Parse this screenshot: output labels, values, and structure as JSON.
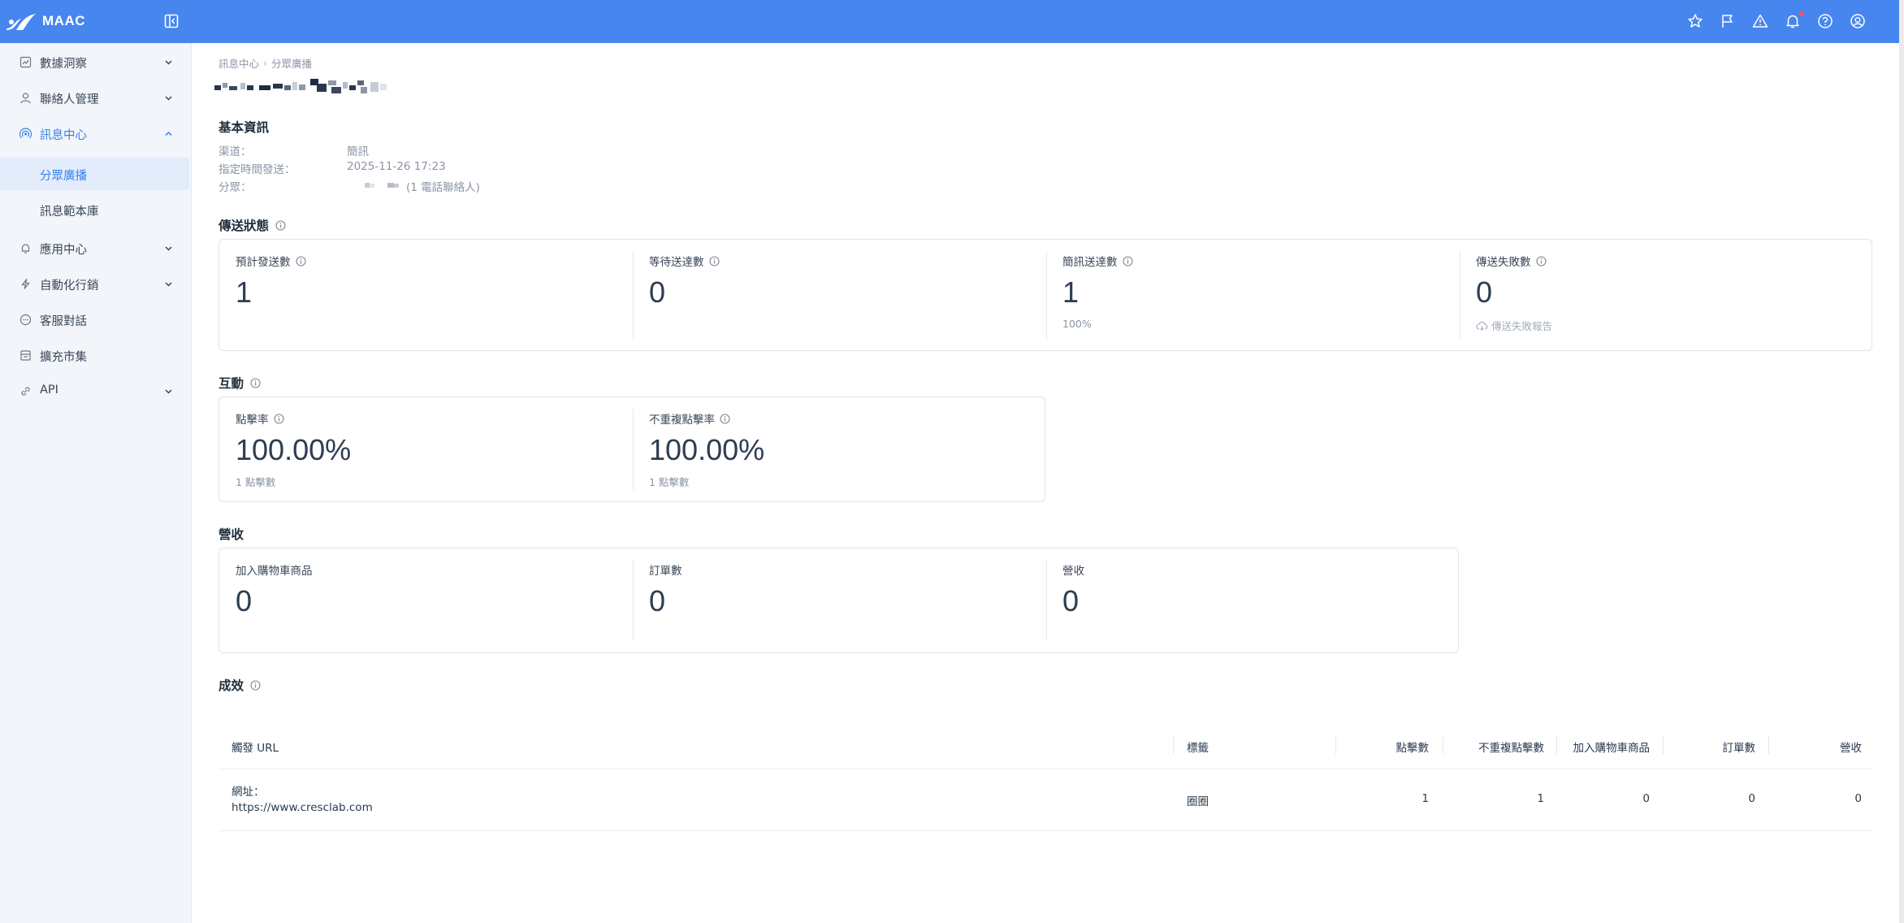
{
  "brand": {
    "name": "MAAC"
  },
  "sidebar": {
    "items": [
      {
        "label": "數據洞察",
        "icon": "chart-icon",
        "expandable": true
      },
      {
        "label": "聯絡人管理",
        "icon": "user-icon",
        "expandable": true
      },
      {
        "label": "訊息中心",
        "icon": "broadcast-icon",
        "expandable": true,
        "open": true,
        "children": [
          {
            "label": "分眾廣播",
            "active": true
          },
          {
            "label": "訊息範本庫"
          }
        ]
      },
      {
        "label": "應用中心",
        "icon": "bell-icon",
        "expandable": true
      },
      {
        "label": "自動化行銷",
        "icon": "bolt-icon",
        "expandable": true
      },
      {
        "label": "客服對話",
        "icon": "chat-icon",
        "expandable": false
      },
      {
        "label": "擴充市集",
        "icon": "store-icon",
        "expandable": false
      },
      {
        "label": "API",
        "icon": "link-icon",
        "expandable": true
      }
    ]
  },
  "topbar": {
    "icons": [
      "star-icon",
      "flag-icon",
      "warning-icon",
      "bell-icon",
      "help-icon",
      "account-icon"
    ],
    "accent": "#4786ee"
  },
  "breadcrumb": {
    "parent": "訊息中心",
    "separator": "›",
    "current": "分眾廣播"
  },
  "basic_info": {
    "title": "基本資訊",
    "rows": [
      {
        "label": "渠道：",
        "value": "簡訊"
      },
      {
        "label": "指定時間發送：",
        "value": "2025-11-26 17:23"
      },
      {
        "label": "分眾：",
        "value": "(1 電話聯絡人)"
      }
    ]
  },
  "delivery": {
    "title": "傳送狀態",
    "cells": [
      {
        "label": "預計發送數",
        "value": "1",
        "sub": ""
      },
      {
        "label": "等待送達數",
        "value": "0",
        "sub": ""
      },
      {
        "label": "簡訊送達數",
        "value": "1",
        "sub": "100%"
      },
      {
        "label": "傳送失敗數",
        "value": "0",
        "sub": "傳送失敗報告"
      }
    ]
  },
  "interaction": {
    "title": "互動",
    "cells": [
      {
        "label": "點擊率",
        "value": "100.00%",
        "sub": "1 點擊數"
      },
      {
        "label": "不重複點擊率",
        "value": "100.00%",
        "sub": "1 點擊數"
      }
    ]
  },
  "revenue": {
    "title": "營收",
    "cells": [
      {
        "label": "加入購物車商品",
        "value": "0"
      },
      {
        "label": "訂單數",
        "value": "0"
      },
      {
        "label": "營收",
        "value": "0"
      }
    ]
  },
  "performance": {
    "title": "成效",
    "headers": [
      "觸發 URL",
      "標籤",
      "點擊數",
      "不重複點擊數",
      "加入購物車商品",
      "訂單數",
      "營收"
    ],
    "rows": [
      {
        "url_label": "網址：",
        "url": "https://www.cresclab.com",
        "tag": "圈圈",
        "clicks": "1",
        "unique_clicks": "1",
        "cart": "0",
        "orders": "0",
        "revenue": "0"
      }
    ]
  }
}
